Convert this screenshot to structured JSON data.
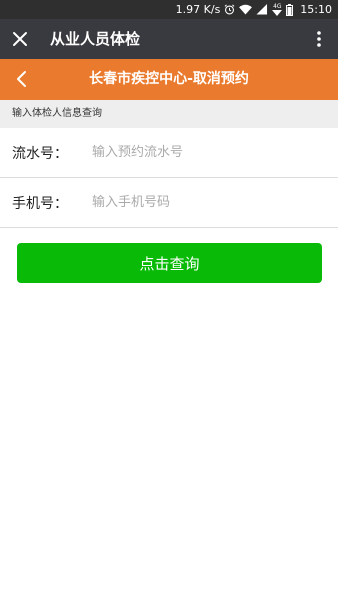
{
  "status_bar": {
    "network_speed": "1.97 K/s",
    "time": "15:10",
    "network_type": "4G",
    "icons": [
      "alarm-icon",
      "wifi-icon",
      "signal-icon",
      "battery-icon"
    ]
  },
  "app_bar": {
    "title": "从业人员体检",
    "close_icon": "close-icon",
    "more_icon": "more-icon"
  },
  "header": {
    "title": "长春市疾控中心-取消预约",
    "back_icon": "back-icon",
    "color": "#ea7b2e"
  },
  "section": {
    "label": "输入体检人信息查询"
  },
  "form": {
    "serial": {
      "label": "流水号：",
      "placeholder": "输入预约流水号",
      "value": ""
    },
    "phone": {
      "label": "手机号：",
      "placeholder": "输入手机号码",
      "value": ""
    }
  },
  "query_button": {
    "label": "点击查询",
    "color": "#09bb07"
  }
}
